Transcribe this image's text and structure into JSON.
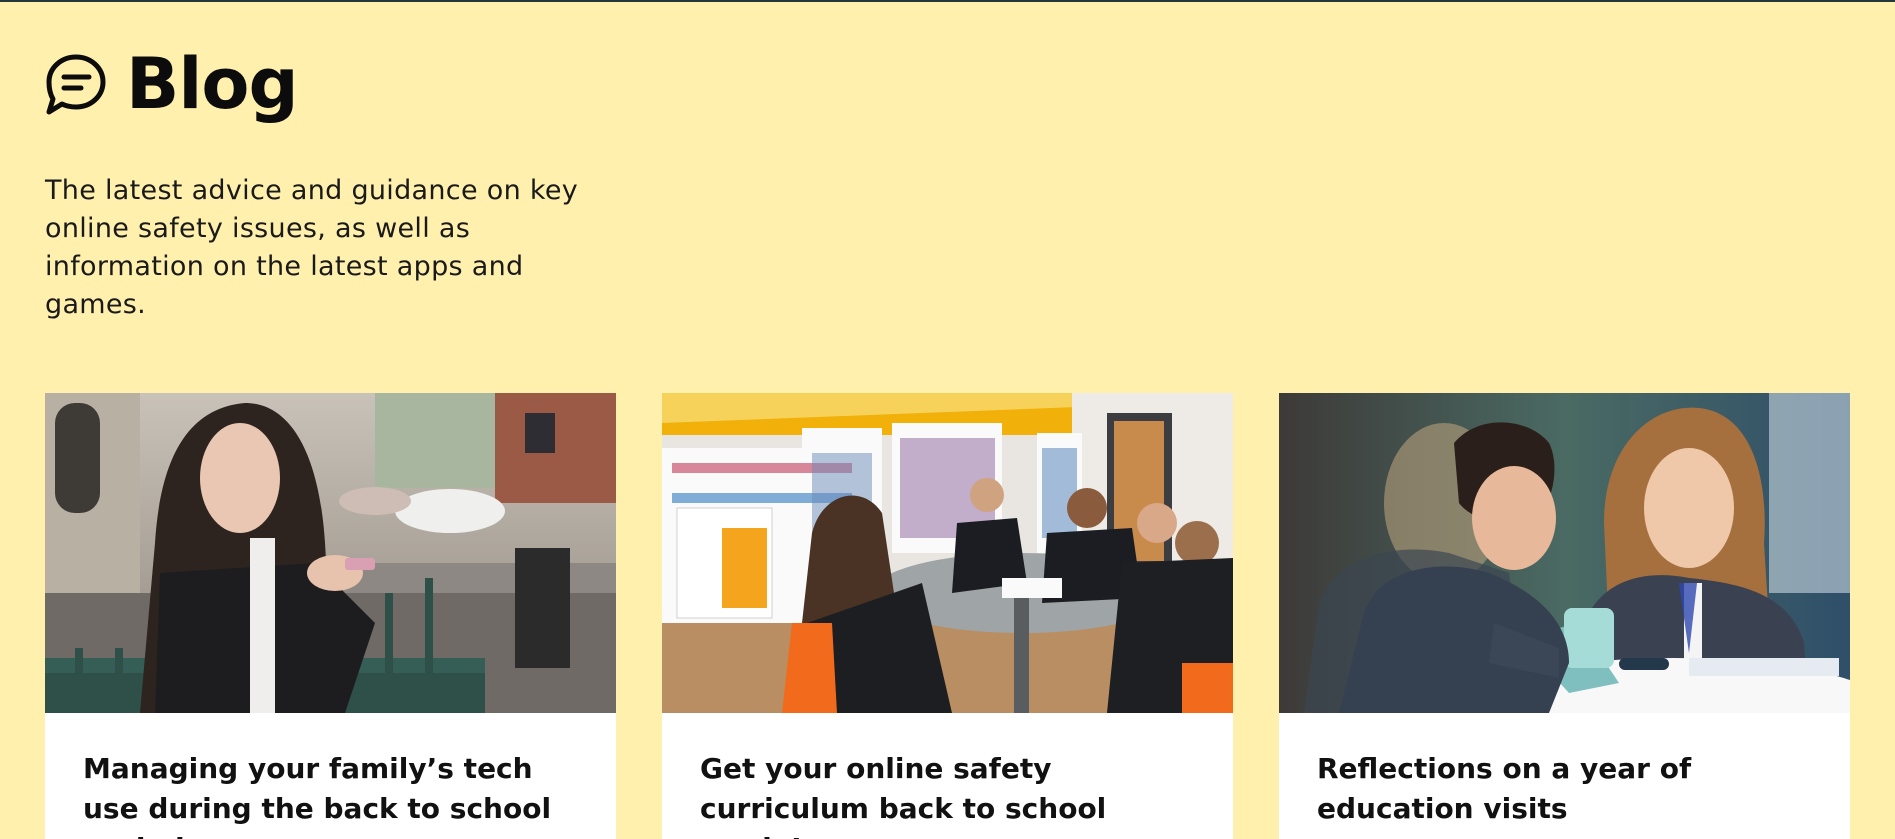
{
  "page": {
    "title": "Blog",
    "intro": "The latest advice and guidance on key online safety issues, as well as information on the latest apps and games.",
    "title_icon": "speech-bubble-icon"
  },
  "colors": {
    "background": "#fff0ae",
    "card": "#ffffff",
    "text": "#111111"
  },
  "cards": [
    {
      "title": "Managing your family’s tech use during the back to school period",
      "image": "girl-using-phone-by-railing"
    },
    {
      "title": "Get your online safety curriculum back to school ready!",
      "image": "students-at-library-table"
    },
    {
      "title": "Reflections on a year of education visits",
      "image": "pupils-writing-at-desk"
    }
  ]
}
